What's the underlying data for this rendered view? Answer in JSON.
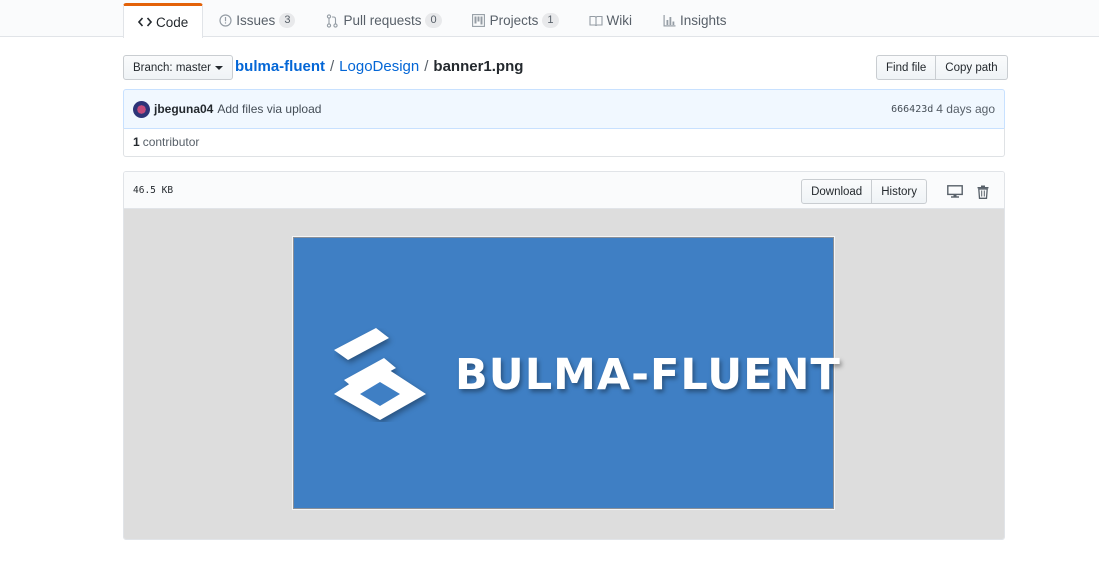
{
  "tabs": [
    {
      "label": "Code",
      "icon": "code-icon",
      "selected": true
    },
    {
      "label": "Issues",
      "icon": "issue-icon",
      "count": "3"
    },
    {
      "label": "Pull requests",
      "icon": "pull-request-icon",
      "count": "0"
    },
    {
      "label": "Projects",
      "icon": "project-icon",
      "count": "1"
    },
    {
      "label": "Wiki",
      "icon": "book-icon"
    },
    {
      "label": "Insights",
      "icon": "graph-icon"
    }
  ],
  "branch": {
    "label": "Branch:",
    "name": "master"
  },
  "breadcrumb": {
    "repo": "bulma-fluent",
    "folder": "LogoDesign",
    "file": "banner1.png",
    "sep": "/"
  },
  "file_nav": {
    "find_file": "Find file",
    "copy_path": "Copy path"
  },
  "commit": {
    "author": "jbeguna04",
    "message": "Add files via upload",
    "sha": "666423d",
    "time": "4 days ago"
  },
  "contributors": {
    "count": "1",
    "label": "contributor"
  },
  "file": {
    "size": "46.5 KB",
    "download": "Download",
    "history": "History"
  },
  "image": {
    "logo_text": "BULMA-FLUENT",
    "background": "#3f7fc4"
  },
  "colors": {
    "link": "#0366d6",
    "tab_accent": "#e36209",
    "commit_bg": "#f1f8ff"
  }
}
